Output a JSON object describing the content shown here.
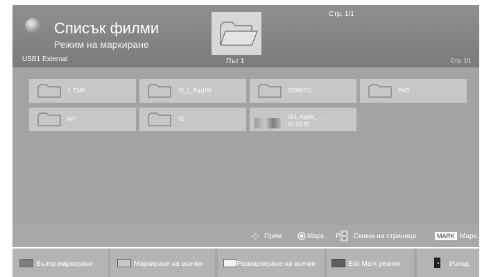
{
  "header": {
    "title": "Списък филми",
    "mode": "Режим на маркиране",
    "source": "USB1 External",
    "path": "Път 1",
    "page_top": "Стр. 1/1",
    "page_right": "Стр. 1/1"
  },
  "files": [
    {
      "name": "1. EMF",
      "type": "folder"
    },
    {
      "name": "10_1_Top100",
      "type": "folder"
    },
    {
      "name": "20090711",
      "type": "folder"
    },
    {
      "name": "FHD",
      "type": "folder"
    },
    {
      "name": "MV",
      "type": "folder"
    },
    {
      "name": "TS",
      "type": "folder"
    },
    {
      "name": "051. Apple_ ....",
      "duration": "02:30:25",
      "type": "video"
    }
  ],
  "hints": {
    "move": "Прем.",
    "mark": "Марк.",
    "page_key": "P",
    "page_change": "Смяна на страница",
    "mark_key": "MARK",
    "mark2": "Марк."
  },
  "buttons": [
    {
      "label": "Възпр.маркирани",
      "color": "#7e7e7e"
    },
    {
      "label": "Маркиране на всички",
      "color": "#c8c8c8"
    },
    {
      "label": "Размаркиране на всички",
      "color": "#f2f2f2"
    },
    {
      "label": "Exit Mark режим",
      "color": "#5f5f5f"
    },
    {
      "label": "Изход",
      "icon": "exit-door-icon"
    }
  ]
}
